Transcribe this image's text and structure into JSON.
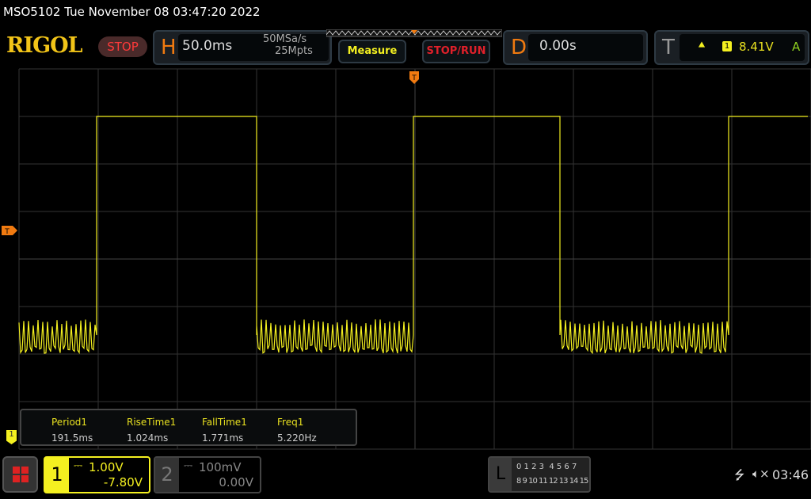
{
  "title": "MSO5102  Tue November 08 03:47:20 2022",
  "logo": "RIGOL",
  "run_state": "STOP",
  "horizontal": {
    "letter": "H",
    "timebase": "50.0ms",
    "sample_rate": "50MSa/s",
    "memory_depth": "25Mpts"
  },
  "buttons": {
    "measure": "Measure",
    "stop_run": "STOP/RUN"
  },
  "delay": {
    "letter": "D",
    "value": "0.00s"
  },
  "trigger": {
    "letter": "T",
    "source": "1",
    "level": "8.41V",
    "mode": "A",
    "marker": "T"
  },
  "measurements": [
    {
      "label": "Period1",
      "value": "191.5ms"
    },
    {
      "label": "RiseTime1",
      "value": "1.024ms"
    },
    {
      "label": "FallTime1",
      "value": "1.771ms"
    },
    {
      "label": "Freq1",
      "value": "5.220Hz"
    }
  ],
  "channels": [
    {
      "number": "1",
      "scale": "1.00V",
      "offset": "-7.80V",
      "color": "#f4f020"
    },
    {
      "number": "2",
      "scale": "100mV",
      "offset": "0.00V",
      "color": "#777777"
    }
  ],
  "ch1_marker": "1",
  "logic": {
    "letter": "L",
    "row1": "0 1 2 3  4 5 6 7",
    "row2": "8 9 10 11 12 13 14 15"
  },
  "status": {
    "time": "03:46"
  },
  "waveform": {
    "edges_div": [
      0.98,
      3.0,
      4.98,
      6.83,
      8.96
    ],
    "high_div": 3.0,
    "low_div": -1.6
  }
}
